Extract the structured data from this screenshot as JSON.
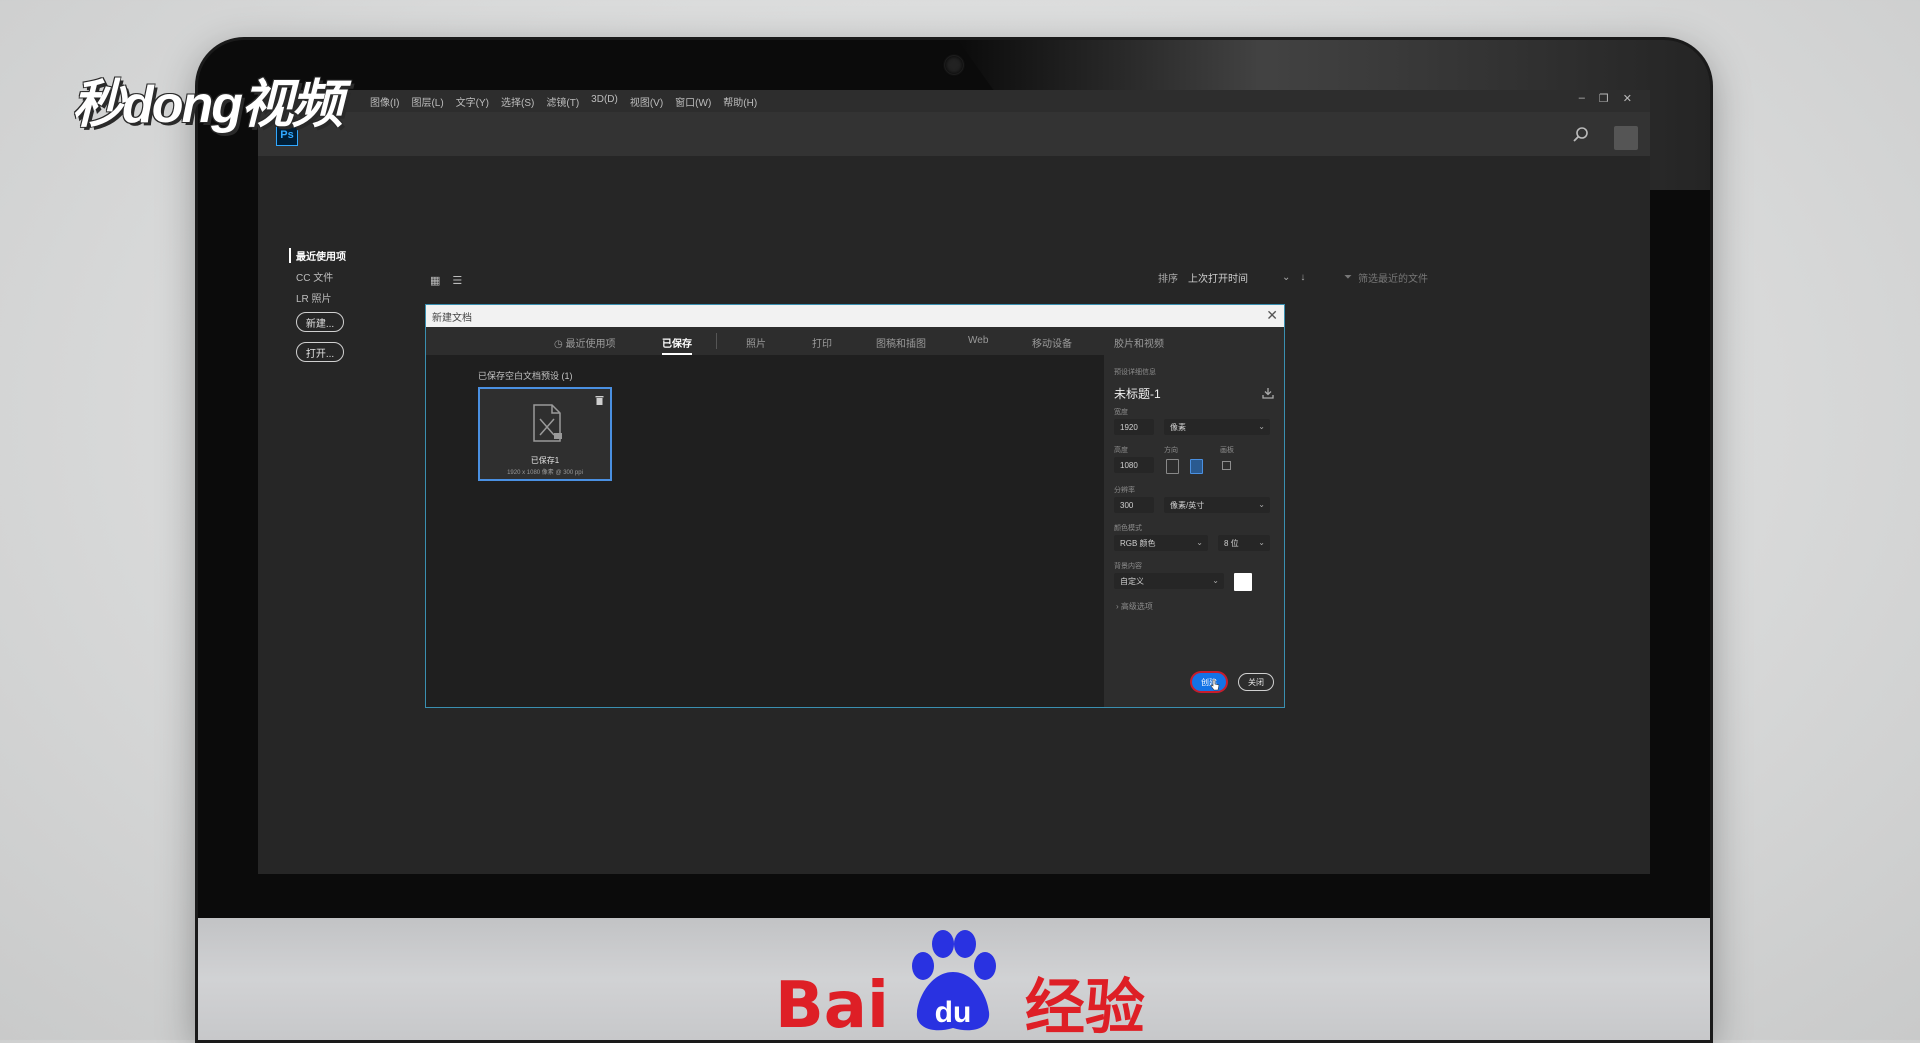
{
  "watermark": {
    "brand": "秒dong视频"
  },
  "footer_logo": {
    "bai": "Bai",
    "du": "du",
    "jingyan": "经验"
  },
  "ps": {
    "logo": "Ps",
    "menus": [
      "图像(I)",
      "图层(L)",
      "文字(Y)",
      "选择(S)",
      "滤镜(T)",
      "3D(D)",
      "视图(V)",
      "窗口(W)",
      "帮助(H)"
    ],
    "window_controls": [
      "–",
      "❐",
      "✕"
    ]
  },
  "home": {
    "nav": [
      "最近使用项",
      "CC 文件",
      "LR 照片"
    ],
    "new_button": "新建...",
    "open_button": "打开...",
    "sort_label": "排序",
    "sort_value": "上次打开时间",
    "filter_placeholder": "筛选最近的文件"
  },
  "dialog": {
    "title": "新建文档",
    "tabs": [
      "最近使用项",
      "已保存",
      "照片",
      "打印",
      "图稿和插图",
      "Web",
      "移动设备",
      "胶片和视频"
    ],
    "active_tab": "已保存",
    "preset_heading": "已保存空白文档预设",
    "preset_count": "(1)",
    "preset": {
      "name": "已保存1",
      "size": "1920 x 1080 像素 @ 300 ppi"
    },
    "details": {
      "section_label": "预设详细信息",
      "doc_title": "未标题-1",
      "width_label": "宽度",
      "width_value": "1920",
      "width_unit": "像素",
      "height_label": "高度",
      "height_value": "1080",
      "orientation_label": "方向",
      "artboard_label": "画板",
      "resolution_label": "分辨率",
      "resolution_value": "300",
      "resolution_unit": "像素/英寸",
      "color_mode_label": "颜色模式",
      "color_mode_value": "RGB 颜色",
      "bit_depth_value": "8 位",
      "background_label": "背景内容",
      "background_value": "自定义",
      "background_color": "#ffffff",
      "advanced_label": "高级选项",
      "create_button": "创建",
      "close_button": "关闭"
    }
  },
  "colors": {
    "accent_blue": "#1473e6",
    "baidu_red": "#de1f26",
    "ps_blue": "#31a8ff"
  }
}
